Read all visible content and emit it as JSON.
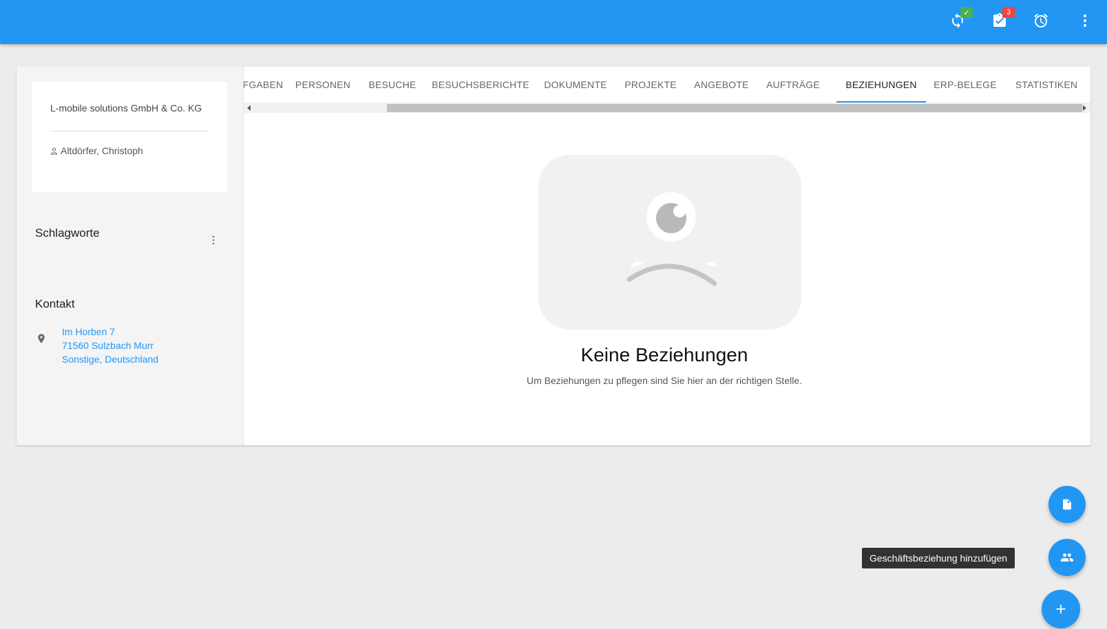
{
  "topbar": {
    "icons": {
      "sync": "sync-icon",
      "tasks": "task-check-icon",
      "alarm": "alarm-clock-icon",
      "more": "more-vert-icon"
    },
    "sync_status": "✓",
    "tasks_badge": "3",
    "colors": {
      "bar": "#2196f3",
      "sync_badge": "#4caf50",
      "tasks_badge": "#f44336"
    }
  },
  "company": {
    "name": "L-mobile solutions GmbH & Co. KG",
    "contact_person": "Altdörfer, Christoph"
  },
  "sections": {
    "tags_title": "Schlagworte",
    "contact_title": "Kontakt"
  },
  "address": {
    "street": "Im Horben 7",
    "city": "71560 Sulzbach Murr",
    "region": "Sonstige, Deutschland"
  },
  "tabs": [
    {
      "label": "AUFGABEN",
      "active": false
    },
    {
      "label": "PERSONEN",
      "active": false
    },
    {
      "label": "BESUCHE",
      "active": false
    },
    {
      "label": "BESUCHSBERICHTE",
      "active": false
    },
    {
      "label": "DOKUMENTE",
      "active": false
    },
    {
      "label": "PROJEKTE",
      "active": false
    },
    {
      "label": "ANGEBOTE",
      "active": false
    },
    {
      "label": "AUFTRÄGE",
      "active": false
    },
    {
      "label": "BEZIEHUNGEN",
      "active": true
    },
    {
      "label": "ERP-BELEGE",
      "active": false
    },
    {
      "label": "STATISTIKEN",
      "active": false
    }
  ],
  "empty_state": {
    "title": "Keine Beziehungen",
    "subtitle": "Um Beziehungen zu pflegen sind Sie hier an der richtigen Stelle."
  },
  "fab": {
    "document_icon": "document-icon",
    "relationship_icon": "people-icon",
    "add_icon": "plus-icon",
    "tooltip": "Geschäftsbeziehung hinzufügen"
  }
}
